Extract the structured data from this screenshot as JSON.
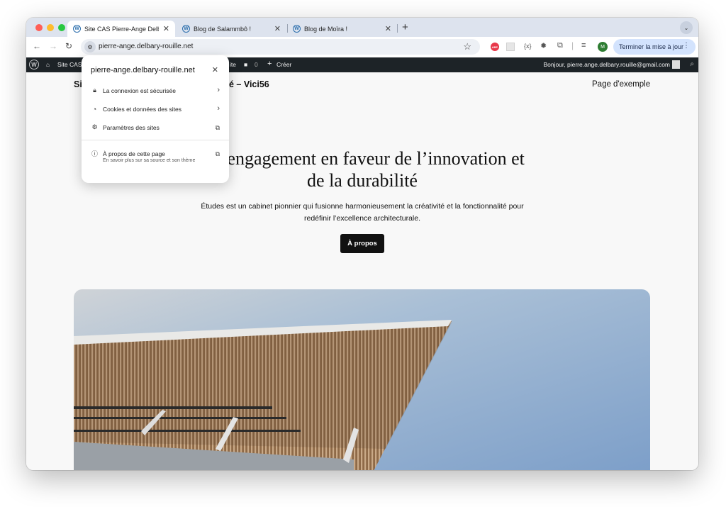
{
  "tabs": [
    {
      "title": "Site CAS Pierre-Ange Delbary"
    },
    {
      "title": "Blog de Salammbô !"
    },
    {
      "title": "Blog de Moïra !"
    }
  ],
  "toolbar": {
    "url": "pierre-ange.delbary-rouille.net",
    "profile_initial": "M",
    "update_label": "Terminer la mise à jour"
  },
  "adminbar": {
    "site_label": "Site CAS",
    "comments_count": "0",
    "create_label": "Créer",
    "greeting": "Bonjour, pierre.ange.delbary.rouille@gmail.com"
  },
  "popup": {
    "domain": "pierre-ange.delbary-rouille.net",
    "rows": [
      {
        "label": "La connexion est sécurisée"
      },
      {
        "label": "Cookies et données des sites"
      },
      {
        "label": "Paramètres des sites"
      },
      {
        "label": "À propos de cette page"
      }
    ],
    "about_sub": "En savoir plus sur sa source et son thème"
  },
  "site": {
    "title_left": "Si",
    "title_right": "é – Vici56",
    "nav_link": "Page d'exemple",
    "hero_title": "Un engagement en faveur de l’innovation et de la durabilité",
    "hero_text": "Études est un cabinet pionnier qui fusionne harmonieusement la créativité et la fonctionnalité pour redéfinir l’excellence architecturale.",
    "hero_button": "À propos"
  },
  "colors": {
    "adminbar": "#1d2327",
    "tabstrip": "#dde3ee",
    "update_button": "#d3e3fd",
    "hero_button": "#111111"
  }
}
